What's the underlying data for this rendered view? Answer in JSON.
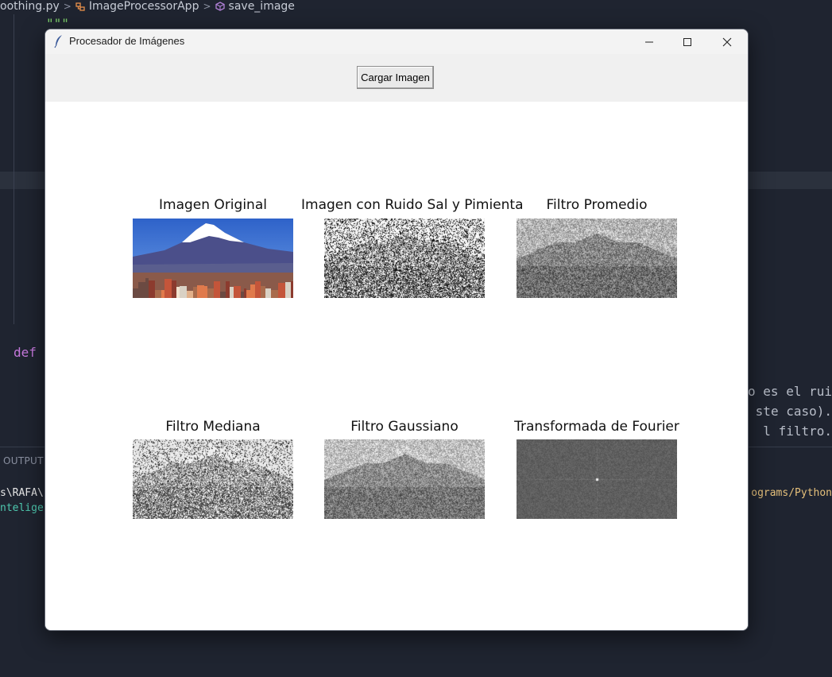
{
  "editor": {
    "breadcrumb": [
      "oothing.py",
      "ImageProcessorApp",
      "save_image"
    ],
    "quotes": "\"\"\"",
    "def_keyword": "def",
    "right_line_1": "o es el rui",
    "right_line_2": "ste caso).",
    "right_line_3": "l filtro.",
    "output_tab": "OUTPUT",
    "term_left_1": "s\\RAFA\\",
    "term_left_2": "nteliger",
    "term_right_1": "ograms/Python"
  },
  "window": {
    "title": "Procesador de Imágenes",
    "controls": {
      "minimize": "minimize",
      "maximize": "maximize",
      "close": "close"
    },
    "load_button": "Cargar Imagen",
    "images": [
      {
        "label": "Imagen Original",
        "kind": "original"
      },
      {
        "label": "Imagen con Ruido Sal y Pimienta",
        "kind": "saltpepper"
      },
      {
        "label": "Filtro Promedio",
        "kind": "mean"
      },
      {
        "label": "Filtro Mediana",
        "kind": "median"
      },
      {
        "label": "Filtro Gaussiano",
        "kind": "gaussian"
      },
      {
        "label": "Transformada de Fourier",
        "kind": "fourier"
      }
    ]
  },
  "colors": {
    "editor_bg": "#1f2430",
    "window_bg": "#ffffff",
    "toolbar_bg": "#f0f0f0",
    "sky": "#3c6fd0",
    "snow": "#ffffff",
    "city": "#b55a3a"
  }
}
